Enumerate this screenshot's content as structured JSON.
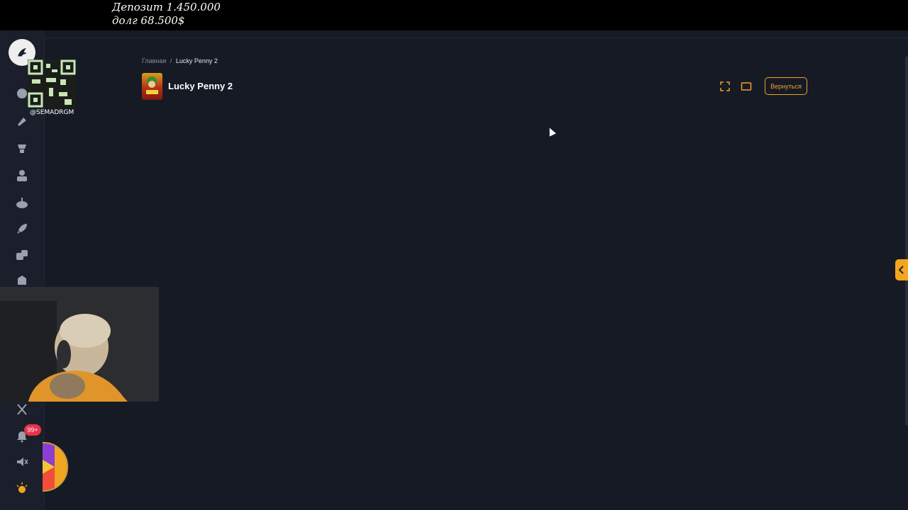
{
  "overlay": {
    "deposit_text": "Депозит 1.450.000",
    "debt_text": "долг 68.500$"
  },
  "stream": {
    "qr_handle": "@SEMADRGM"
  },
  "sidebar": {
    "icons": [
      "logo-icon",
      "slots-icon",
      "sports-icon",
      "tournament-icon",
      "user-icon",
      "joystick-icon",
      "rocket-icon",
      "dice-icon",
      "store-icon",
      "x-icon",
      "bell-icon",
      "sound-off-icon",
      "light-icon"
    ],
    "notification_count": "99+"
  },
  "breadcrumb": {
    "home": "Главная",
    "separator": "/",
    "current": "Lucky Penny 2"
  },
  "game": {
    "title": "Lucky Penny 2"
  },
  "controls": {
    "back_label": "Вернуться"
  },
  "colors": {
    "accent": "#f0a22a",
    "background": "#161a25",
    "sidebar": "#1b1f2b",
    "badge": "#e8334a"
  }
}
